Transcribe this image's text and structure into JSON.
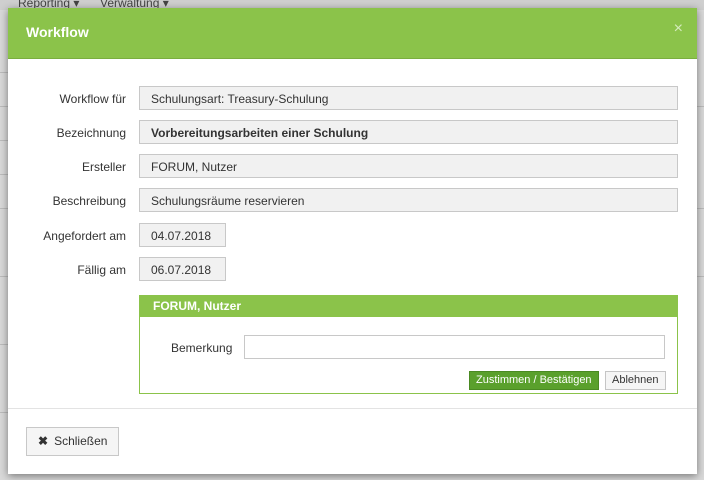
{
  "background": {
    "menu": [
      "Reporting ▾",
      "Verwaltung ▾"
    ]
  },
  "modal": {
    "title": "Workflow",
    "close_glyph": "×",
    "fields": [
      {
        "label": "Workflow für",
        "value": "Schulungsart: Treasury-Schulung"
      },
      {
        "label": "Bezeichnung",
        "value": "Vorbereitungsarbeiten einer Schulung"
      },
      {
        "label": "Ersteller",
        "value": "FORUM, Nutzer"
      },
      {
        "label": "Beschreibung",
        "value": "Schulungsräume reservieren"
      },
      {
        "label": "Angefordert am",
        "value": "04.07.2018"
      },
      {
        "label": "Fällig am",
        "value": "06.07.2018"
      }
    ],
    "approval": {
      "title": "FORUM, Nutzer",
      "remark_label": "Bemerkung",
      "remark_value": "",
      "approve_label": "Zustimmen / Bestätigen",
      "reject_label": "Ablehnen"
    },
    "footer": {
      "close_label": "Schließen",
      "close_icon_glyph": "✖"
    }
  },
  "colors": {
    "accent": "#8bc34a",
    "approve": "#5aa02c"
  }
}
